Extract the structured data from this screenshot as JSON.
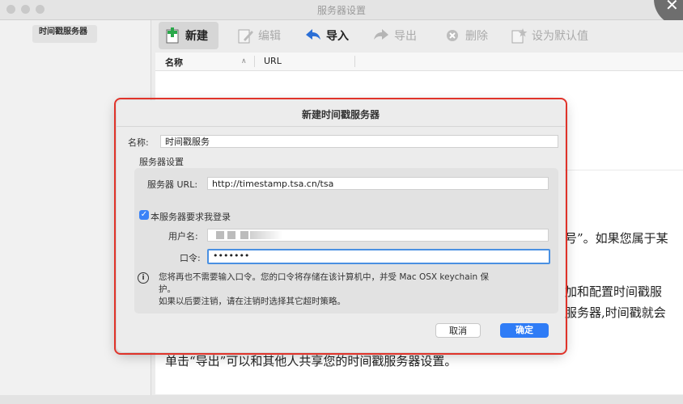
{
  "window": {
    "title": "服务器设置"
  },
  "sidebar": {
    "items": [
      {
        "label": "时间戳服务器"
      }
    ]
  },
  "toolbar": {
    "new_label": "新建",
    "edit_label": "编辑",
    "import_label": "导入",
    "export_label": "导出",
    "delete_label": "删除",
    "set_default_label": "设为默认值"
  },
  "table": {
    "columns": [
      "名称",
      "URL"
    ]
  },
  "background_text": {
    "line1": "号”。如果您属于某",
    "line2": "加和配置时间戳服",
    "line3": "服务器,时间戳就会",
    "line4": "单击“导出”可以和其他人共享您的时间戳服务器设置。"
  },
  "dialog": {
    "title": "新建时间戳服务器",
    "name_label": "名称:",
    "name_value": "时间戳服务",
    "section_label": "服务器设置",
    "url_label": "服务器 URL:",
    "url_value": "http://timestamp.tsa.cn/tsa",
    "login_checkbox_label": "本服务器要求我登录",
    "login_checked": true,
    "username_label": "用户名:",
    "password_label": "口令:",
    "password_value": "•••••••",
    "info_line1": "您将再也不需要输入口令。您的口令将存储在该计算机中，并受 Mac OSX keychain 保",
    "info_line2": "护。",
    "info_line3": "如果以后要注销，请在注销时选择其它超时策略。",
    "cancel_label": "取消",
    "ok_label": "确定"
  },
  "colors": {
    "accent": "#2f7cf6",
    "highlight_outline": "#e0332a"
  }
}
